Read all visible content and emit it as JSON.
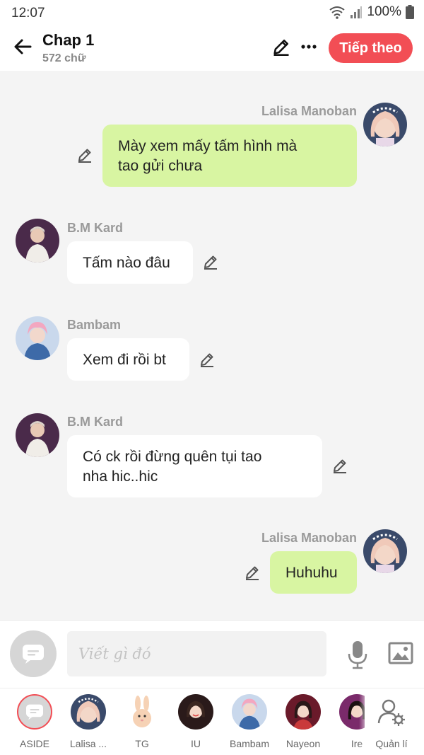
{
  "status": {
    "time": "12:07",
    "battery": "100%"
  },
  "header": {
    "title": "Chap 1",
    "word_count": "572 chữ",
    "next_label": "Tiếp theo",
    "accent": "#f24e55"
  },
  "messages": [
    {
      "sender": "Lalisa Manoban",
      "text_lines": [
        "Mày xem mấy tấm hình mà",
        "tao gửi chưa"
      ],
      "side": "right",
      "avatar": "lisa-avatar"
    },
    {
      "sender": "B.M Kard",
      "text_lines": [
        "Tấm nào đâu"
      ],
      "side": "left",
      "avatar": "bm-avatar"
    },
    {
      "sender": "Bambam",
      "text_lines": [
        "Xem đi rồi bt"
      ],
      "side": "left",
      "avatar": "bambam-avatar"
    },
    {
      "sender": "B.M Kard",
      "text_lines": [
        "Có ck rồi đừng quên tụi tao",
        "nha hic..hic"
      ],
      "side": "left",
      "avatar": "bm-avatar"
    },
    {
      "sender": "Lalisa Manoban",
      "text_lines": [
        "Huhuhu"
      ],
      "side": "right",
      "avatar": "lisa-avatar"
    }
  ],
  "input": {
    "placeholder": "Viết gì đó"
  },
  "characters": [
    {
      "label": "ASIDE",
      "icon": "chat-bubble-icon"
    },
    {
      "label": "Lalisa ...",
      "icon": "lisa-avatar"
    },
    {
      "label": "TG",
      "icon": "bunny-avatar"
    },
    {
      "label": "IU",
      "icon": "iu-avatar"
    },
    {
      "label": "Bambam",
      "icon": "bambam-avatar"
    },
    {
      "label": "Nayeon",
      "icon": "nayeon-avatar"
    },
    {
      "label": "Ire",
      "icon": "irene-avatar"
    },
    {
      "label": "Quản lí",
      "icon": "manage-user-icon"
    }
  ]
}
